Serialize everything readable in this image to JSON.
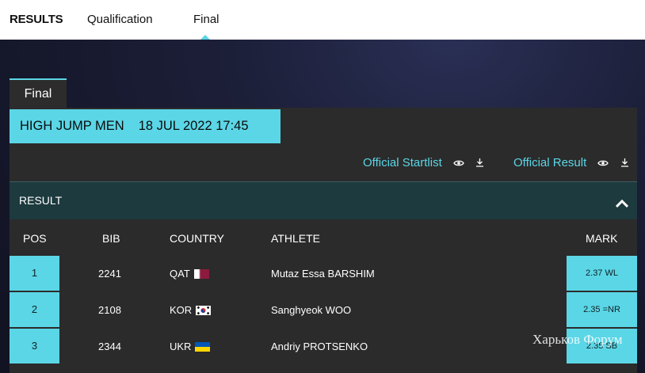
{
  "nav": {
    "results": "RESULTS",
    "qualification": "Qualification",
    "final": "Final"
  },
  "final_tab": "Final",
  "event": {
    "name": "HIGH JUMP MEN",
    "datetime": "18 JUL 2022 17:45"
  },
  "links": {
    "startlist": "Official Startlist",
    "result": "Official Result"
  },
  "result_section": "RESULT",
  "columns": {
    "pos": "POS",
    "bib": "BIB",
    "country": "COUNTRY",
    "athlete": "ATHLETE",
    "mark": "MARK"
  },
  "rows": [
    {
      "pos": "1",
      "bib": "2241",
      "country": "QAT",
      "athlete": "Mutaz Essa BARSHIM",
      "mark": "2.37 WL"
    },
    {
      "pos": "2",
      "bib": "2108",
      "country": "KOR",
      "athlete": "Sanghyeok WOO",
      "mark": "2.35 =NR"
    },
    {
      "pos": "3",
      "bib": "2344",
      "country": "UKR",
      "athlete": "Andriy PROTSENKO",
      "mark": "2.35 SB"
    }
  ],
  "watermark": "Харьков Форум",
  "colors": {
    "accent": "#5bd6e6",
    "panel": "#2b2b2b",
    "result_bar": "#1d3a3e"
  }
}
